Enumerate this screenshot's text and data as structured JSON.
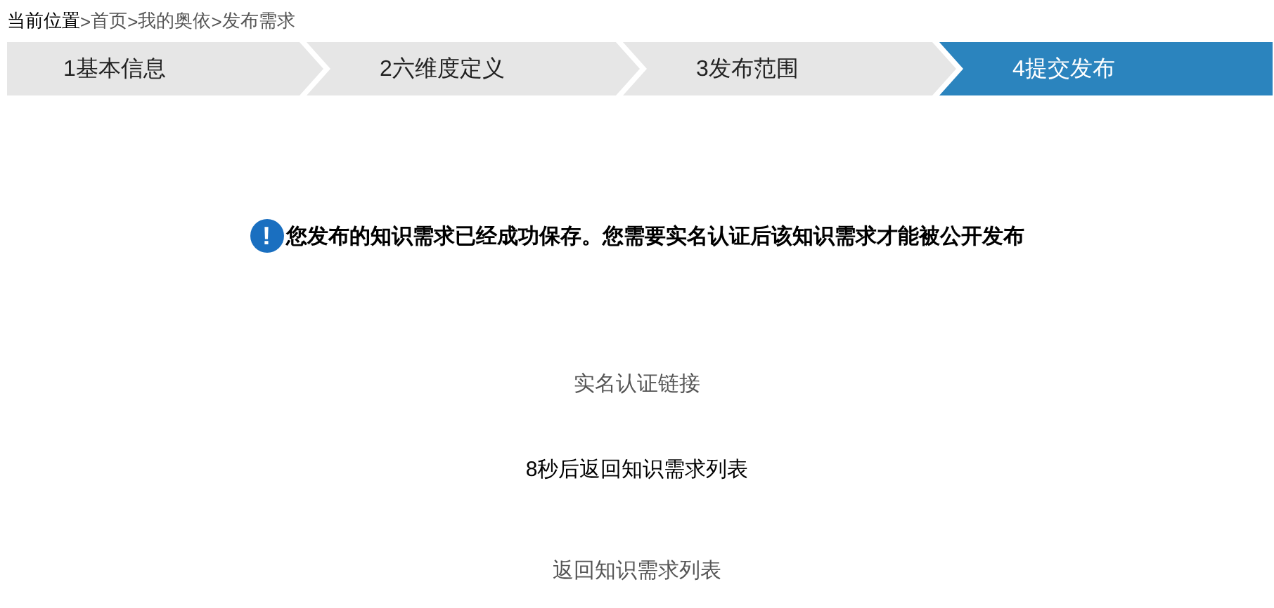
{
  "breadcrumb": {
    "label": "当前位置",
    "separator": ">",
    "items": [
      "首页",
      "我的奥依",
      "发布需求"
    ]
  },
  "steps": [
    {
      "label": "1基本信息",
      "selected": false
    },
    {
      "label": "2六维度定义",
      "selected": false
    },
    {
      "label": "3发布范围",
      "selected": false
    },
    {
      "label": "4提交发布",
      "selected": true
    }
  ],
  "notice": {
    "icon_text": "!",
    "message": "您发布的知识需求已经成功保存。您需要实名认证后该知识需求才能被公开发布"
  },
  "verify_link": "实名认证链接",
  "countdown": "8秒后返回知识需求列表",
  "back_link": "返回知识需求列表"
}
